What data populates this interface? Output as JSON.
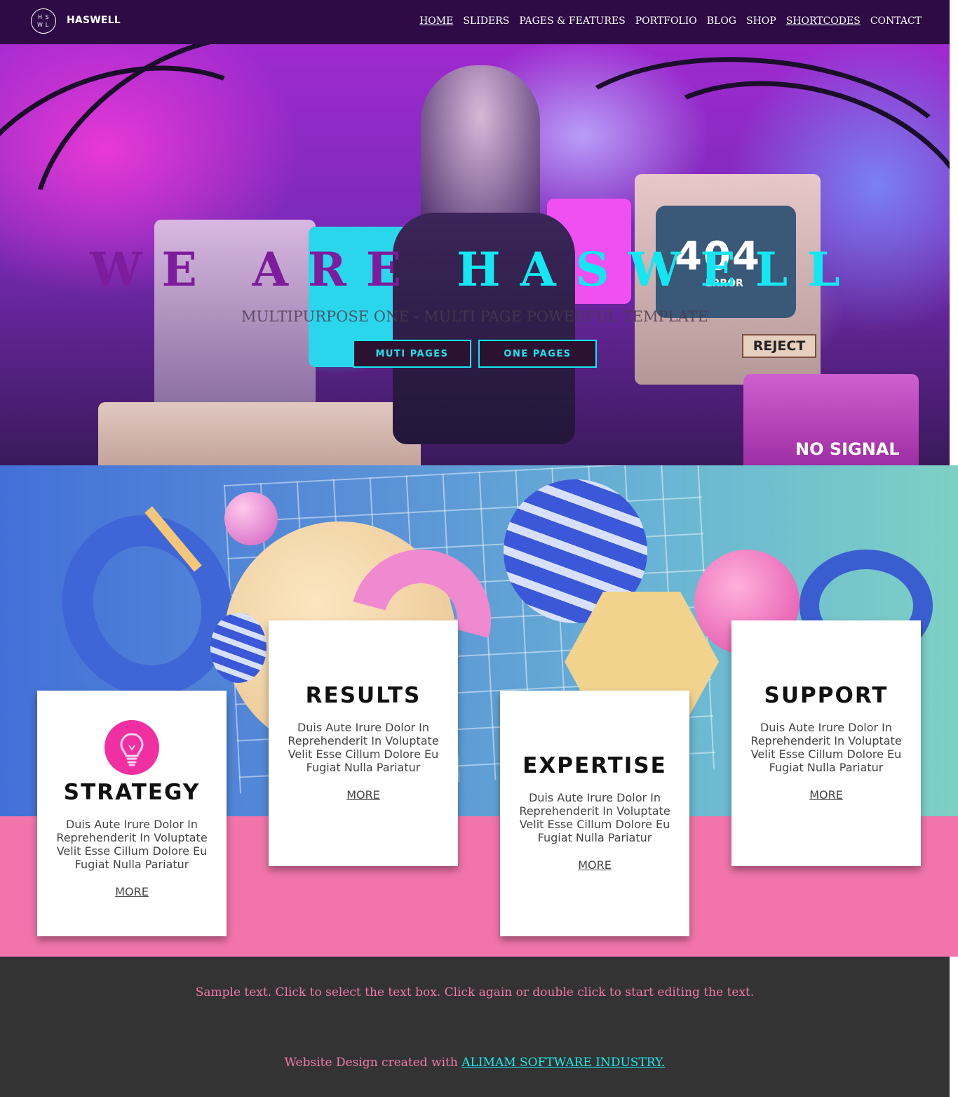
{
  "header": {
    "logo_letters": [
      "H",
      "S",
      "W",
      "L"
    ],
    "brand": "HASWELL",
    "nav": [
      {
        "label": "HOME",
        "underlined": true
      },
      {
        "label": "SLIDERS",
        "underlined": false
      },
      {
        "label": "PAGES & FEATURES",
        "underlined": false
      },
      {
        "label": "PORTFOLIO",
        "underlined": false
      },
      {
        "label": "BLOG",
        "underlined": false
      },
      {
        "label": "SHOP",
        "underlined": false
      },
      {
        "label": "SHORTCODES",
        "underlined": true
      },
      {
        "label": "CONTACT",
        "underlined": false
      }
    ]
  },
  "hero": {
    "title_part1": "WE ARE",
    "title_part2": "HASWELL",
    "subtitle": "MULTIPURPOSE ONE - MULTI PAGE POWERFUL TEMPLATE",
    "buttons": [
      "MUTI PAGES",
      "ONE PAGES"
    ],
    "monitor_labels": [
      "404",
      "ERROR",
      "REJECT",
      "NO SIGNAL"
    ]
  },
  "features": {
    "cards": [
      {
        "title": "STRATEGY",
        "text": "Duis Aute Irure Dolor In Reprehenderit In Voluptate Velit Esse Cillum Dolore Eu Fugiat Nulla Pariatur",
        "link": "MORE",
        "icon": "lightbulb-icon"
      },
      {
        "title": "RESULTS",
        "text": "Duis Aute Irure Dolor In Reprehenderit In Voluptate Velit Esse Cillum Dolore Eu Fugiat Nulla Pariatur",
        "link": "MORE"
      },
      {
        "title": "EXPERTISE",
        "text": "Duis Aute Irure Dolor In Reprehenderit In Voluptate Velit Esse Cillum Dolore Eu Fugiat Nulla Pariatur",
        "link": "MORE"
      },
      {
        "title": "SUPPORT",
        "text": "Duis Aute Irure Dolor In Reprehenderit In Voluptate Velit Esse Cillum Dolore Eu Fugiat Nulla Pariatur",
        "link": "MORE"
      }
    ]
  },
  "footer": {
    "sample_text": "Sample text. Click to select the text box. Click again or double click to start editing the text.",
    "credit_prefix": "Website Design created with ",
    "credit_link": "ALIMAM SOFTWARE INDUSTRY."
  },
  "colors": {
    "nav_bg": "#2e0b45",
    "accent_cyan": "#14e6f2",
    "title_purple": "#7d1c9c",
    "icon_pink": "#f02fa0",
    "section_pink": "#f175aa",
    "footer_bg": "#333333",
    "footer_text": "#f07aaa"
  }
}
